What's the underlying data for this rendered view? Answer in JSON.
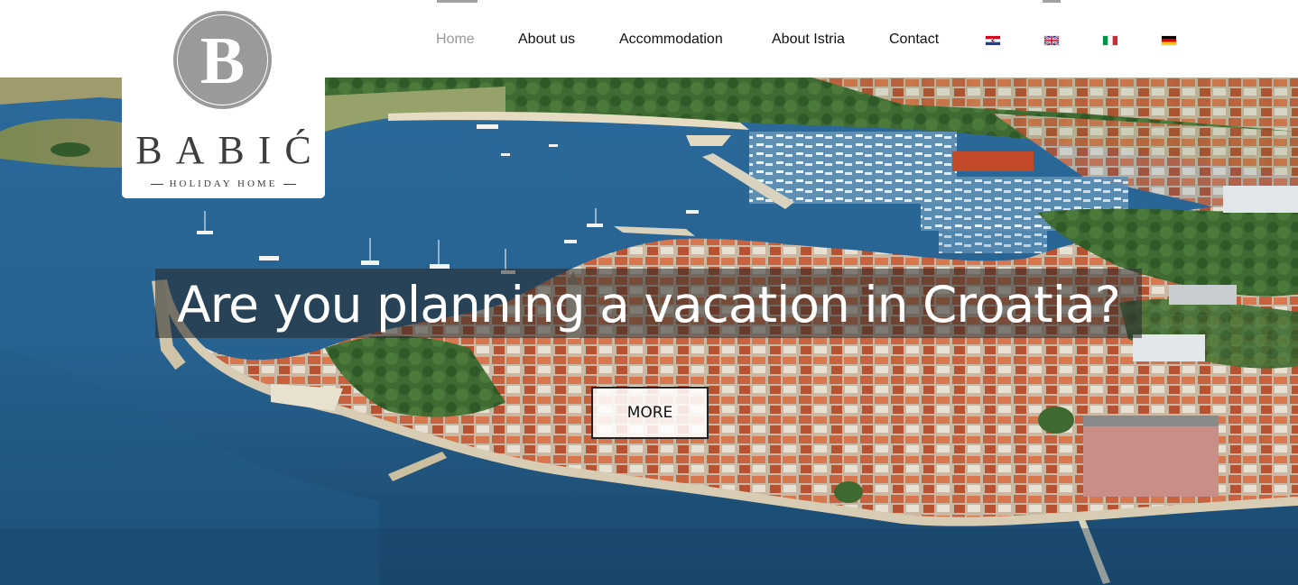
{
  "logo": {
    "monogram": "B",
    "name": "BABIĆ",
    "tagline": "HOLIDAY HOME"
  },
  "nav": {
    "items": [
      {
        "label": "Home",
        "active": true
      },
      {
        "label": "About us",
        "active": false
      },
      {
        "label": "Accommodation",
        "active": false
      },
      {
        "label": "About Istria",
        "active": false
      },
      {
        "label": "Contact",
        "active": false
      }
    ],
    "languages": [
      {
        "icon": "croatian-flag-icon",
        "colors": [
          "#d6001c",
          "#ffffff",
          "#1f3f95"
        ]
      },
      {
        "icon": "uk-flag-icon",
        "colors": [
          "#1a3a8c",
          "#ffffff",
          "#c8102e"
        ],
        "selected": true
      },
      {
        "icon": "italian-flag-icon",
        "colors": [
          "#009246",
          "#ffffff",
          "#ce2b37"
        ]
      },
      {
        "icon": "german-flag-icon",
        "colors": [
          "#000000",
          "#dd0000",
          "#ffce00"
        ]
      }
    ]
  },
  "hero": {
    "headline": "Are you planning a vacation in Croatia?",
    "cta_label": "MORE"
  },
  "colors": {
    "accent_gray": "#9a9a9a",
    "nav_text": "#111111",
    "nav_active": "#999999",
    "sea": "#2b6ea0"
  }
}
